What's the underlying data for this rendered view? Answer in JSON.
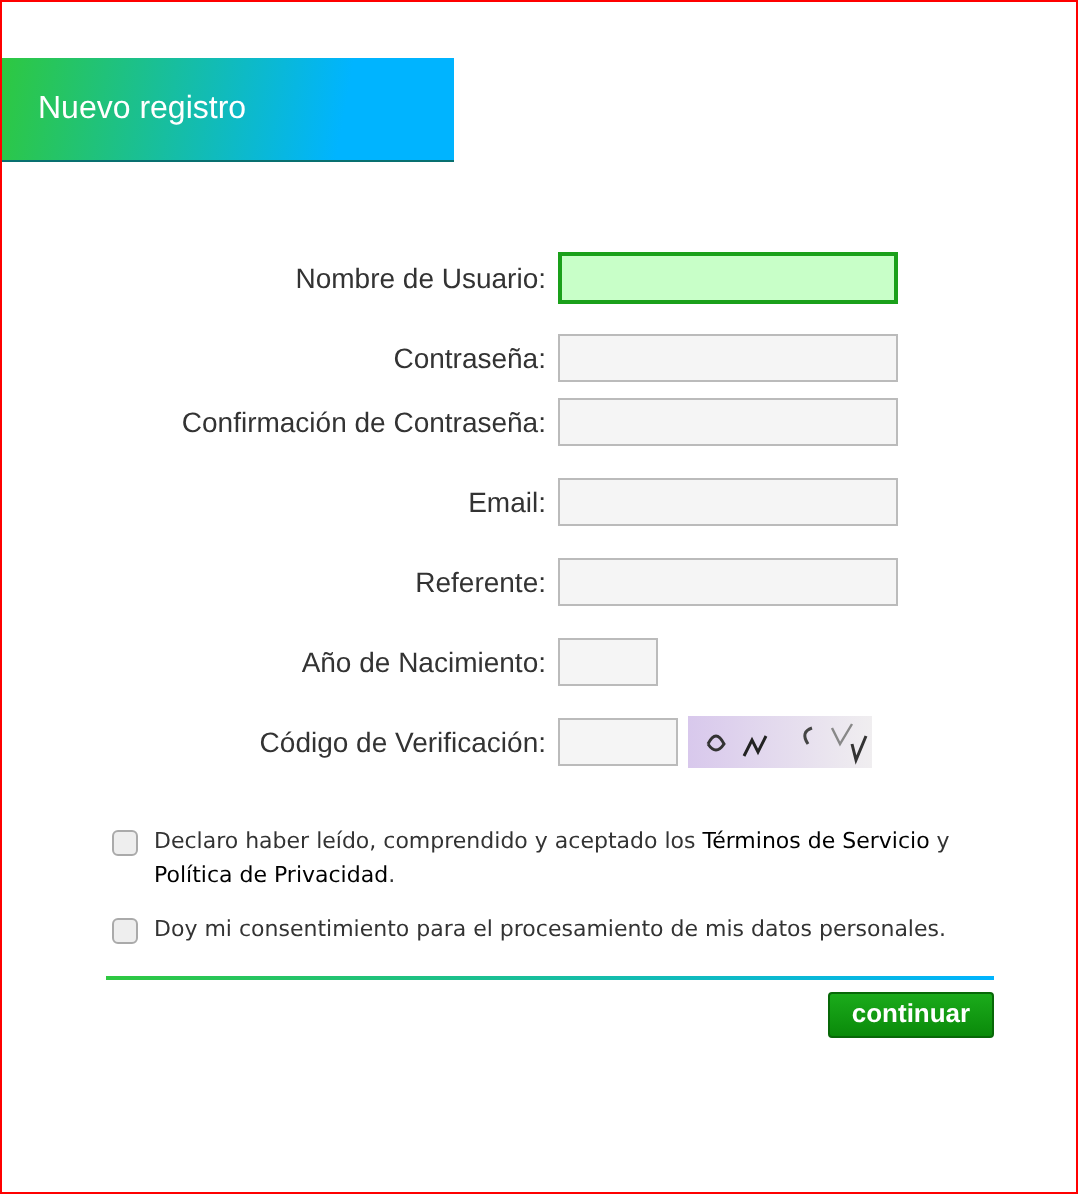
{
  "header": {
    "title": "Nuevo registro"
  },
  "field_groups": [
    [
      {
        "label": "Nombre de Usuario:",
        "kind": "text",
        "focused": true
      }
    ],
    [
      {
        "label": "Contraseña:",
        "kind": "text",
        "focused": false
      },
      {
        "label": "Confirmación de Contraseña:",
        "kind": "text",
        "focused": false
      }
    ],
    [
      {
        "label": "Email:",
        "kind": "text",
        "focused": false
      }
    ],
    [
      {
        "label": "Referente:",
        "kind": "text",
        "focused": false
      }
    ],
    [
      {
        "label": "Año de Nacimiento:",
        "kind": "year",
        "focused": false
      }
    ],
    [
      {
        "label": "Código de Verificación:",
        "kind": "captcha",
        "focused": false
      }
    ]
  ],
  "agreements": [
    {
      "checked": false,
      "parts": [
        {
          "text": "Declaro haber leído, comprendido y aceptado los ",
          "link": false
        },
        {
          "text": "Términos de Servicio",
          "link": true
        },
        {
          "text": " y ",
          "link": false
        },
        {
          "text": "Política de Privacidad",
          "link": true
        },
        {
          "text": ".",
          "link": false
        }
      ]
    },
    {
      "checked": false,
      "parts": [
        {
          "text": "Doy mi consentimiento para el procesamiento de mis datos personales.",
          "link": false
        }
      ]
    }
  ],
  "submit_button": "continuar"
}
